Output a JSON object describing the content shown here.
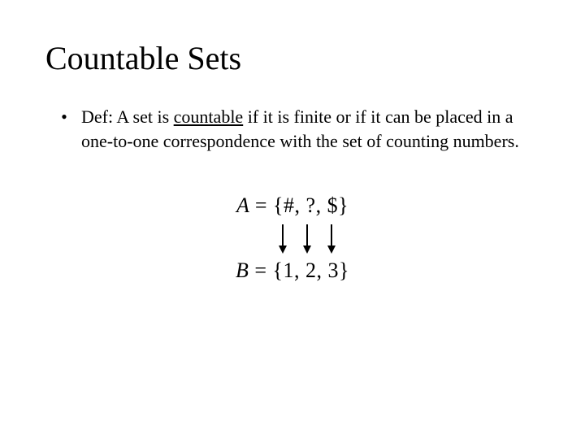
{
  "title": "Countable Sets",
  "bullet": {
    "prefix": "Def: A set is ",
    "term": "countable",
    "suffix": " if it is finite or if it can be placed in a one-to-one correspondence with the set of counting numbers."
  },
  "setA": {
    "lhs": "A",
    "eq": "=",
    "rhs": "{#, ?, $}"
  },
  "setB": {
    "lhs": "B",
    "eq": "=",
    "rhs": "{1, 2, 3}"
  }
}
